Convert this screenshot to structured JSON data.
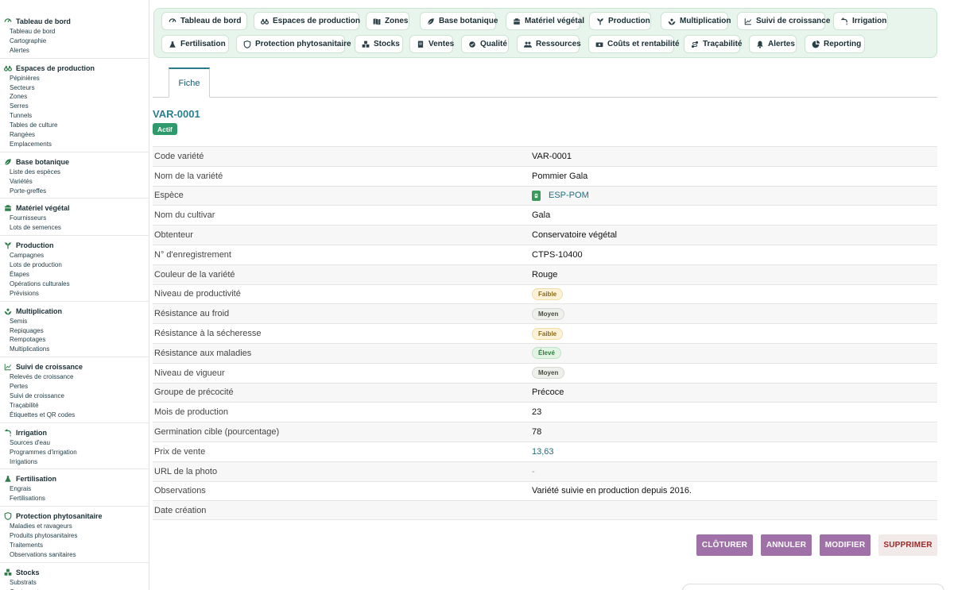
{
  "sidebar": {
    "groups": [
      {
        "title": "Tableau de bord",
        "icon": "gauge-icon",
        "items": [
          "Tableau de bord",
          "Cartographie",
          "Alertes"
        ]
      },
      {
        "title": "Espaces de production",
        "icon": "binoculars-icon",
        "items": [
          "Pépinières",
          "Secteurs",
          "Zones",
          "Serres",
          "Tunnels",
          "Tables de culture",
          "Rangées",
          "Emplacements"
        ]
      },
      {
        "title": "Base botanique",
        "icon": "leaf-icon",
        "items": [
          "Liste des espèces",
          "Variétés",
          "Porte-greffes"
        ]
      },
      {
        "title": "Matériel végétal",
        "icon": "crate-icon",
        "items": [
          "Fournisseurs",
          "Lots de semences"
        ]
      },
      {
        "title": "Production",
        "icon": "seedling-icon",
        "items": [
          "Campagnes",
          "Lots de production",
          "Étapes",
          "Opérations culturales",
          "Prévisions"
        ]
      },
      {
        "title": "Multiplication",
        "icon": "sprout-icon",
        "items": [
          "Semis",
          "Repiquages",
          "Rempotages",
          "Multiplications"
        ]
      },
      {
        "title": "Suivi de croissance",
        "icon": "chart-line-icon",
        "items": [
          "Relevés de croissance",
          "Pertes",
          "Suivi de croissance",
          "Traçabilité",
          "Étiquettes et QR codes"
        ]
      },
      {
        "title": "Irrigation",
        "icon": "faucet-icon",
        "items": [
          "Sources d'eau",
          "Programmes d'irrigation",
          "Irrigations"
        ]
      },
      {
        "title": "Fertilisation",
        "icon": "flask-icon",
        "items": [
          "Engrais",
          "Fertilisations"
        ]
      },
      {
        "title": "Protection phytosanitaire",
        "icon": "shield-icon",
        "items": [
          "Maladies et ravageurs",
          "Produits phytosanitaires",
          "Traitements",
          "Observations sanitaires"
        ]
      },
      {
        "title": "Stocks",
        "icon": "boxes-icon",
        "items": [
          "Substrats",
          "Contenants"
        ]
      }
    ]
  },
  "topnav": {
    "items": [
      {
        "label": "Tableau de bord",
        "icon": "gauge-icon"
      },
      {
        "label": "Espaces de production",
        "icon": "binoculars-icon"
      },
      {
        "label": "Zones",
        "icon": "map-icon"
      },
      {
        "label": "Base botanique",
        "icon": "leaf-icon"
      },
      {
        "label": "Matériel végétal",
        "icon": "crate-icon"
      },
      {
        "label": "Production",
        "icon": "seedling-icon"
      },
      {
        "label": "Multiplication",
        "icon": "sprout-icon"
      },
      {
        "label": "Suivi de croissance",
        "icon": "chart-line-icon"
      },
      {
        "label": "Irrigation",
        "icon": "faucet-icon"
      },
      {
        "label": "Fertilisation",
        "icon": "flask-icon"
      },
      {
        "label": "Protection phytosanitaire",
        "icon": "shield-icon"
      },
      {
        "label": "Stocks",
        "icon": "boxes-icon"
      },
      {
        "label": "Ventes",
        "icon": "receipt-icon"
      },
      {
        "label": "Qualité",
        "icon": "certificate-icon"
      },
      {
        "label": "Ressources",
        "icon": "users-icon"
      },
      {
        "label": "Coûts et rentabilité",
        "icon": "money-icon"
      },
      {
        "label": "Traçabilité",
        "icon": "route-icon"
      },
      {
        "label": "Alertes",
        "icon": "bell-icon"
      },
      {
        "label": "Reporting",
        "icon": "pie-chart-icon"
      }
    ]
  },
  "tabs": {
    "fiche": "Fiche"
  },
  "record": {
    "title": "VAR-0001",
    "status": "Actif",
    "fields": [
      {
        "label": "Code variété",
        "value": "VAR-0001",
        "kind": "text"
      },
      {
        "label": "Nom de la variété",
        "value": "Pommier Gala",
        "kind": "text"
      },
      {
        "label": "Espèce",
        "value": "ESP-POM",
        "kind": "link-icon"
      },
      {
        "label": "Nom du cultivar",
        "value": "Gala",
        "kind": "text"
      },
      {
        "label": "Obtenteur",
        "value": "Conservatoire végétal",
        "kind": "text"
      },
      {
        "label": "N° d'enregistrement",
        "value": "CTPS-10400",
        "kind": "text"
      },
      {
        "label": "Couleur de la variété",
        "value": "Rouge",
        "kind": "text"
      },
      {
        "label": "Niveau de productivité",
        "value": "Faible",
        "kind": "pill-low"
      },
      {
        "label": "Résistance au froid",
        "value": "Moyen",
        "kind": "pill-mid"
      },
      {
        "label": "Résistance à la sécheresse",
        "value": "Faible",
        "kind": "pill-low"
      },
      {
        "label": "Résistance aux maladies",
        "value": "Élevé",
        "kind": "pill-high"
      },
      {
        "label": "Niveau de vigueur",
        "value": "Moyen",
        "kind": "pill-mid"
      },
      {
        "label": "Groupe de précocité",
        "value": "Précoce",
        "kind": "text"
      },
      {
        "label": "Mois de production",
        "value": "23",
        "kind": "text"
      },
      {
        "label": "Germination cible (pourcentage)",
        "value": "78",
        "kind": "text"
      },
      {
        "label": "Prix de vente",
        "value": "13,63",
        "kind": "link"
      },
      {
        "label": "URL de la photo",
        "value": "-",
        "kind": "muted"
      },
      {
        "label": "Observations",
        "value": "Variété suivie en production depuis 2016.",
        "kind": "text"
      },
      {
        "label": "Date création",
        "value": "",
        "kind": "text"
      }
    ]
  },
  "actions": {
    "close": "CLÔTURER",
    "cancel": "ANNULER",
    "edit": "MODIFIER",
    "delete": "SUPPRIMER"
  },
  "colors": {
    "accent": "#2a7f8f",
    "status_active": "#2e9a6b",
    "action_purple": "#a071a8",
    "nav_bg": "#e8f5ec"
  }
}
